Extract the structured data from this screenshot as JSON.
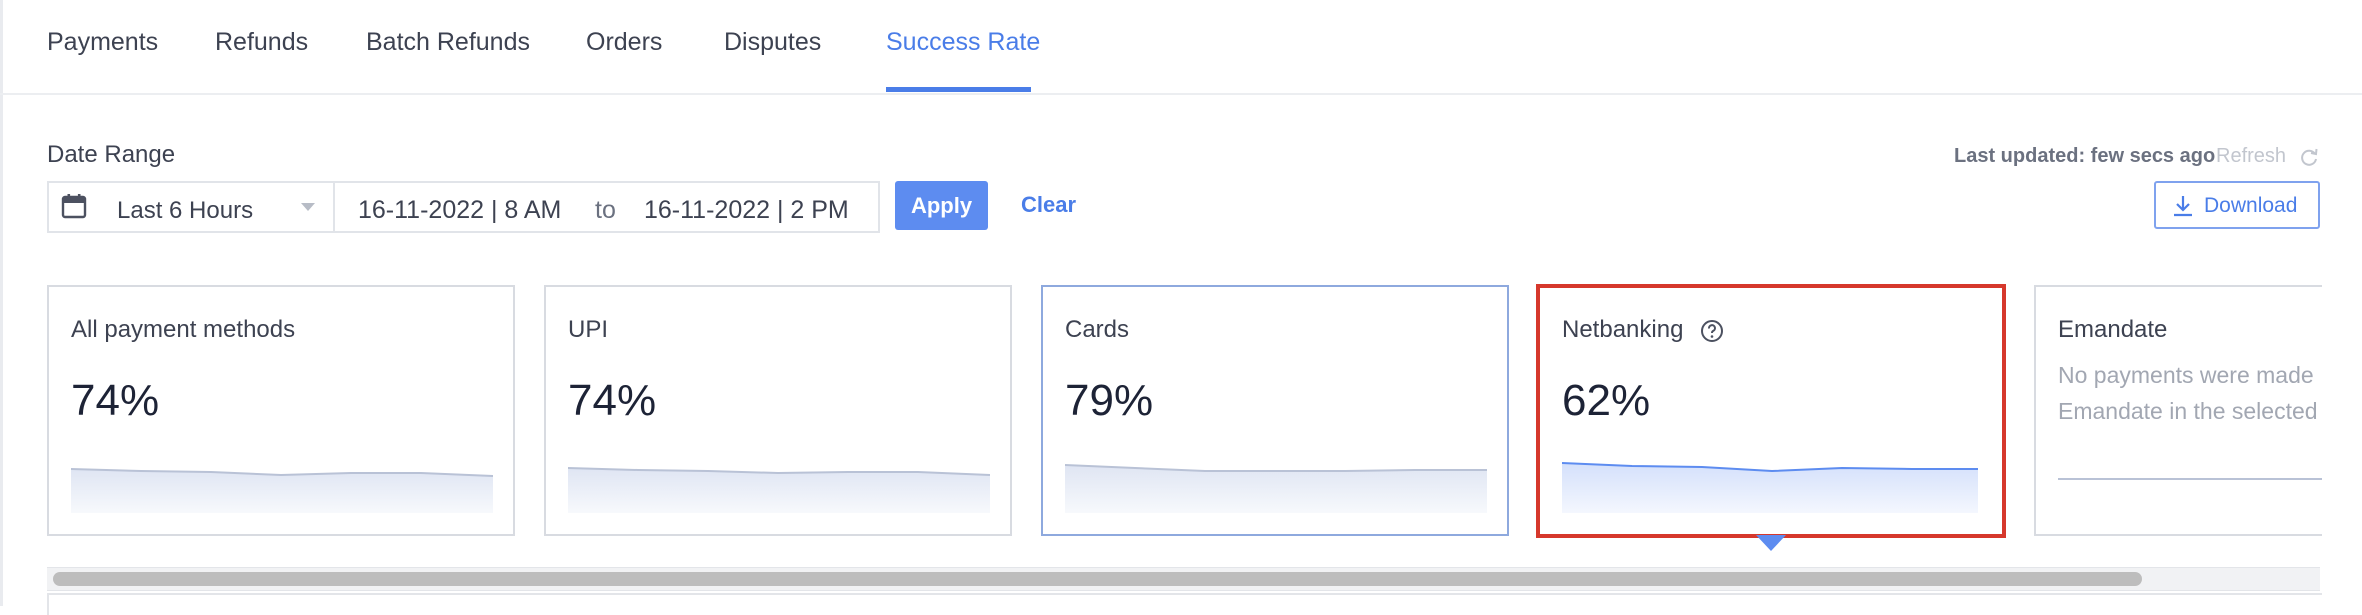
{
  "tabs": [
    {
      "label": "Payments",
      "active": false
    },
    {
      "label": "Refunds",
      "active": false
    },
    {
      "label": "Batch Refunds",
      "active": false
    },
    {
      "label": "Orders",
      "active": false
    },
    {
      "label": "Disputes",
      "active": false
    },
    {
      "label": "Success Rate",
      "active": true
    }
  ],
  "filters": {
    "date_range_label": "Date Range",
    "preset": "Last 6 Hours",
    "from": "16-11-2022 | 8 AM",
    "to_label": "to",
    "to": "16-11-2022 | 2 PM",
    "apply_label": "Apply",
    "clear_label": "Clear"
  },
  "status": {
    "last_updated": "Last updated: few secs ago",
    "refresh_label": "Refresh"
  },
  "download_label": "Download",
  "cards": [
    {
      "title": "All payment methods",
      "value": "74%",
      "selected": false
    },
    {
      "title": "UPI",
      "value": "74%",
      "selected": false
    },
    {
      "title": "Cards",
      "value": "79%",
      "selected": false
    },
    {
      "title": "Netbanking",
      "value": "62%",
      "selected": true,
      "highlighted": true
    },
    {
      "title": "Emandate",
      "message_line1": "No payments were made",
      "message_line2": "Emandate in the selected"
    }
  ],
  "colors": {
    "accent": "#4a7de8",
    "apply_bg": "#5d8cf0",
    "highlight": "#d6382c",
    "text": "#3d4251"
  },
  "icons": {
    "date_picker": "calendar-icon",
    "preset_dropdown": "caret-down-icon",
    "refresh": "refresh-icon",
    "download": "download-icon",
    "netbanking_info": "help-circle-icon"
  }
}
